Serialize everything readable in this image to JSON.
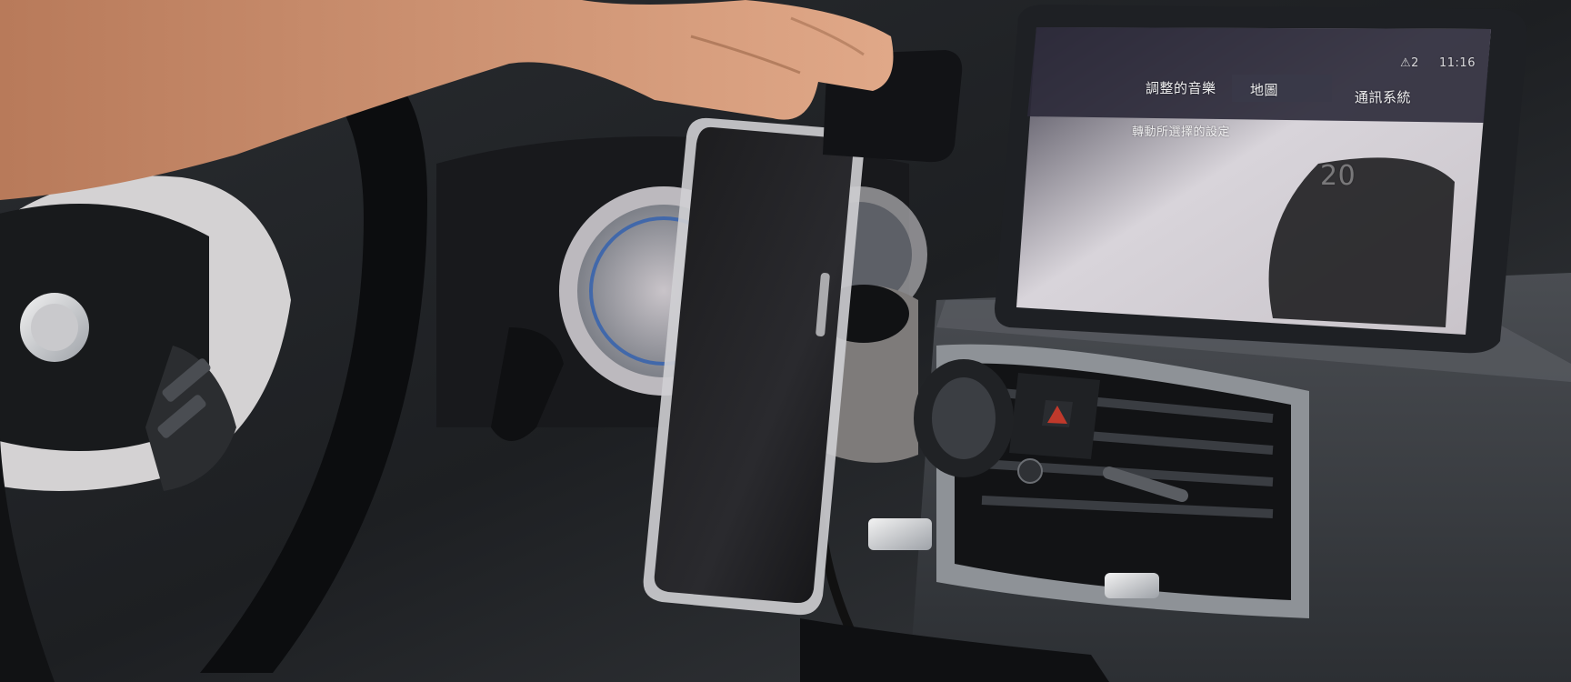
{
  "scene": {
    "background": "#1b1d20",
    "subjects": [
      "hand-icon",
      "steering-wheel-icon",
      "smartphone-icon",
      "car-mount-icon",
      "air-vent-icon",
      "infotainment-screen-icon",
      "hazard-button-icon"
    ]
  },
  "infotainment": {
    "status_warning": "⚠2",
    "status_time": "11:16",
    "menu_item_1": "調整的音樂",
    "menu_item_2": "地圖",
    "menu_item_3": "通訊系統",
    "menu_item_4": "轉動所選擇的設定",
    "temp_value": "20"
  },
  "colors": {
    "accent_hazard": "#c0392b",
    "phone_frame": "#dcdcde",
    "screen_glow": "#e9e6ea",
    "dash_dark": "#202326"
  }
}
